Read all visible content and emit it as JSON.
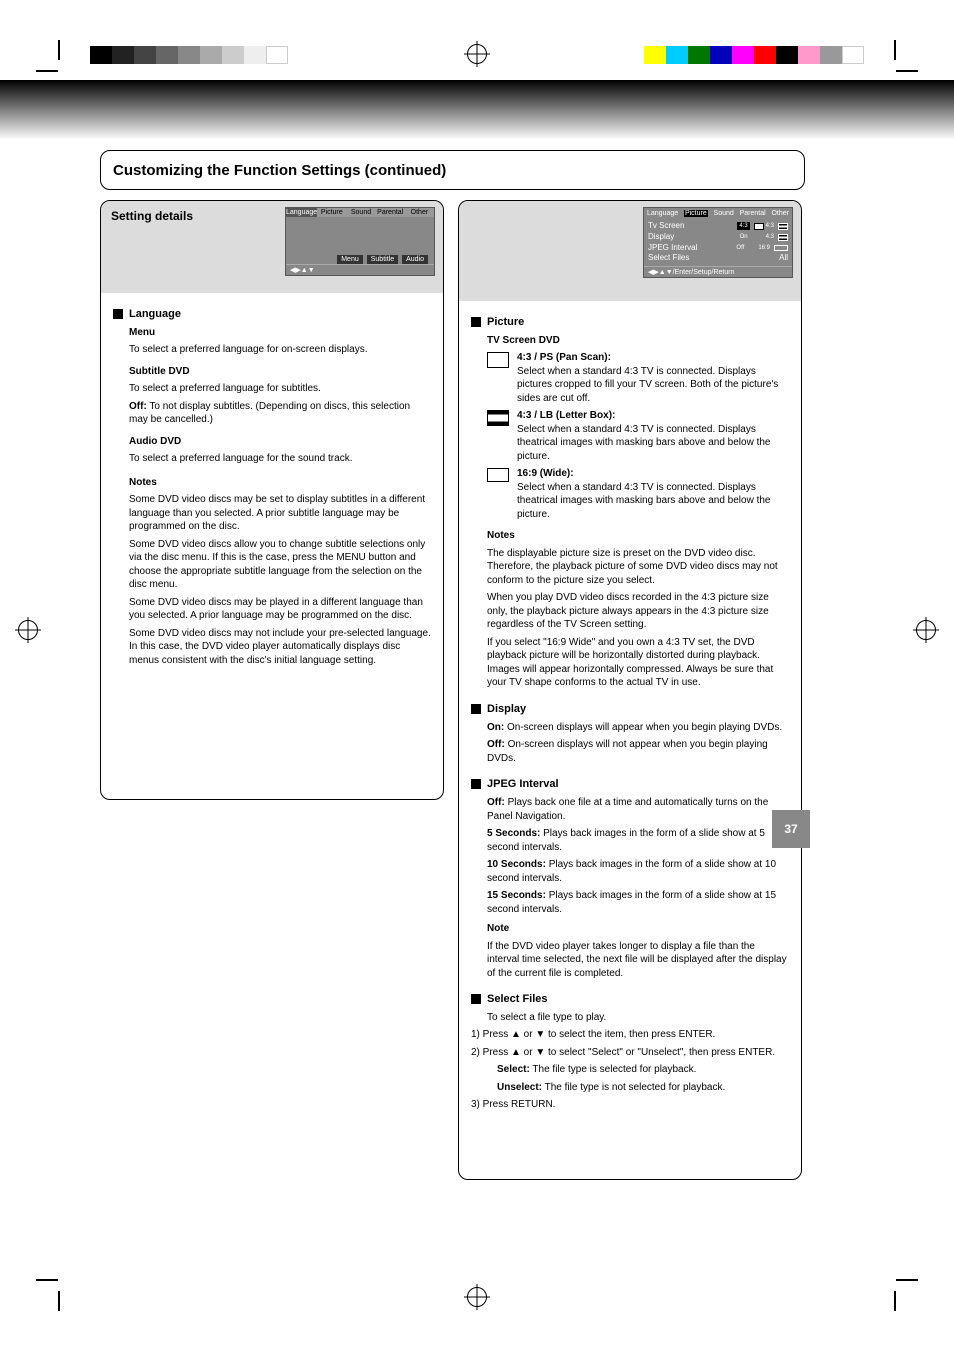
{
  "page": {
    "title": "Customizing the Function Settings (continued)",
    "page_number": "37"
  },
  "left": {
    "heading": "Setting details",
    "osd1": {
      "tabs": [
        "Language",
        "Picture",
        "Sound",
        "Parental",
        "Other"
      ],
      "active_tab": "Language",
      "submenu": [
        "Menu",
        "Subtitle",
        "Audio"
      ],
      "footer": "◀▶▲▼"
    },
    "section_label": "Language",
    "items": [
      {
        "title": "Menu",
        "text": "To select a preferred language for on-screen displays."
      },
      {
        "title": "Subtitle  DVD",
        "text": "To select a preferred language for subtitles.",
        "off": "Off:",
        "off_text": "To not display subtitles. (Depending on discs, this selection may be cancelled.)"
      },
      {
        "title": "Audio  DVD",
        "text": "To select a preferred language for the sound track."
      }
    ],
    "notes_title": "Notes",
    "notes": [
      "Some DVD video discs may be set to display subtitles in a different language than you selected. A prior subtitle language may be programmed on the disc.",
      "Some DVD video discs allow you to change subtitle selections only via the disc menu. If this is the case, press the MENU button and choose the appropriate subtitle language from the selection on the disc menu.",
      "Some DVD video discs may be played in a different language than you selected. A prior language may be programmed on the disc.",
      "Some DVD video discs may not include your pre-selected language. In this case, the DVD video player automatically displays disc menus consistent with the disc's initial language setting."
    ]
  },
  "right": {
    "osd2": {
      "tabs": [
        "Language",
        "Picture",
        "Sound",
        "Parental",
        "Other"
      ],
      "active_tab": "Picture",
      "rows": [
        {
          "label": "Tv Screen",
          "value": "4:3",
          "options": [
            "4:3",
            "4:3",
            "16:9"
          ]
        },
        {
          "label": "Display",
          "value": "On"
        },
        {
          "label": "JPEG Interval",
          "value": "Off"
        },
        {
          "label": "Select Files",
          "value": "All"
        }
      ],
      "footer": "◀▶▲▼/Enter/Setup/Return"
    },
    "picture_label": "Picture",
    "tvscreen": {
      "title": "TV Screen  DVD",
      "opts": [
        {
          "code": "4:3 / PS",
          "name": "(Pan Scan):",
          "text": "Select when a standard 4:3 TV is connected. Displays pictures cropped to fill your TV screen. Both of the picture's sides are cut off."
        },
        {
          "code": "4:3 / LB",
          "name": "(Letter Box):",
          "text": "Select when a standard 4:3 TV is connected. Displays theatrical images with masking bars above and below the picture."
        },
        {
          "code": "16:9",
          "name": "(Wide):",
          "text": "Select when a standard 4:3 TV is connected. Displays theatrical images with masking bars above and below the picture."
        }
      ],
      "notes_title": "Notes",
      "notes": [
        "The displayable picture size is preset on the DVD video disc. Therefore, the playback picture of some DVD video discs may not conform to the picture size you select.",
        "When you play DVD video discs recorded in the 4:3 picture size only, the playback picture always appears in the 4:3 picture size regardless of the TV Screen setting.",
        "If you select \"16:9 Wide\" and you own a 4:3 TV set, the DVD playback picture will be horizontally distorted during playback. Images will appear horizontally compressed. Always be sure that your TV shape conforms to the actual TV in use."
      ]
    },
    "display": {
      "title": "Display",
      "on": "On:",
      "on_text": "On-screen displays will appear when you begin playing DVDs.",
      "off": "Off:",
      "off_text": "On-screen displays will not appear when you begin playing DVDs."
    },
    "jpeg": {
      "title": "JPEG Interval",
      "off": "Off:",
      "off_text": "Plays back one file at a time and automatically turns on the Panel Navigation.",
      "s5": "5 Seconds:",
      "s5_text": "Plays back images in the form of a slide show at 5 second intervals.",
      "s10": "10 Seconds:",
      "s10_text": "Plays back images in the form of a slide show at 10 second intervals.",
      "s15": "15 Seconds:",
      "s15_text": "Plays back images in the form of a slide show at 15 second intervals.",
      "note_title": "Note",
      "note_text": "If the DVD video player takes longer to display a file than the interval time selected, the next file will be displayed after the display of the current file is completed."
    },
    "select_files": {
      "title": "Select Files",
      "text": "To select a file type to play.",
      "step1": "1) Press ▲ or ▼ to select the item, then press ENTER.",
      "step2": "2) Press ▲ or ▼ to select \"Select\" or \"Unselect\", then press ENTER.",
      "s_select": "Select:",
      "s_select_text": "The file type is selected for playback.",
      "s_unselect": "Unselect:",
      "s_unselect_text": "The file type is not selected for playback.",
      "step3": "3) Press RETURN."
    }
  }
}
